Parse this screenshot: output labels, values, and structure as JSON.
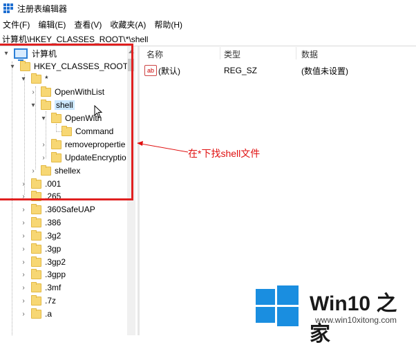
{
  "window": {
    "title": "注册表编辑器"
  },
  "menu": [
    "文件(F)",
    "编辑(E)",
    "查看(V)",
    "收藏夹(A)",
    "帮助(H)"
  ],
  "address": "计算机\\HKEY_CLASSES_ROOT\\*\\shell",
  "tree": [
    {
      "label": "计算机",
      "icon": "computer-icon"
    },
    {
      "label": "HKEY_CLASSES_ROOT"
    },
    {
      "label": "*"
    },
    {
      "label": "OpenWithList"
    },
    {
      "label": "shell"
    },
    {
      "label": "OpenWith"
    },
    {
      "label": "Command"
    },
    {
      "label": "removepropertie"
    },
    {
      "label": "UpdateEncryptio"
    },
    {
      "label": "shellex"
    },
    {
      "label": ".001"
    },
    {
      "label": ".265"
    },
    {
      "label": ".360SafeUAP"
    },
    {
      "label": ".386"
    },
    {
      "label": ".3g2"
    },
    {
      "label": ".3gp"
    },
    {
      "label": ".3gp2"
    },
    {
      "label": ".3gpp"
    },
    {
      "label": ".3mf"
    },
    {
      "label": ".7z"
    },
    {
      "label": ".a"
    }
  ],
  "columns": {
    "name": "名称",
    "type": "类型",
    "data": "数据"
  },
  "values": [
    {
      "name": "(默认)",
      "type": "REG_SZ",
      "data": "(数值未设置)",
      "icon": "ab"
    }
  ],
  "annotation": "在*下找shell文件",
  "watermark": {
    "brand": "Win10",
    "suffix": "之家",
    "url": "www.win10xitong.com"
  },
  "colors": {
    "annotation": "#e01010",
    "selection": "#cce8ff",
    "logo": "#1a8ee0"
  }
}
